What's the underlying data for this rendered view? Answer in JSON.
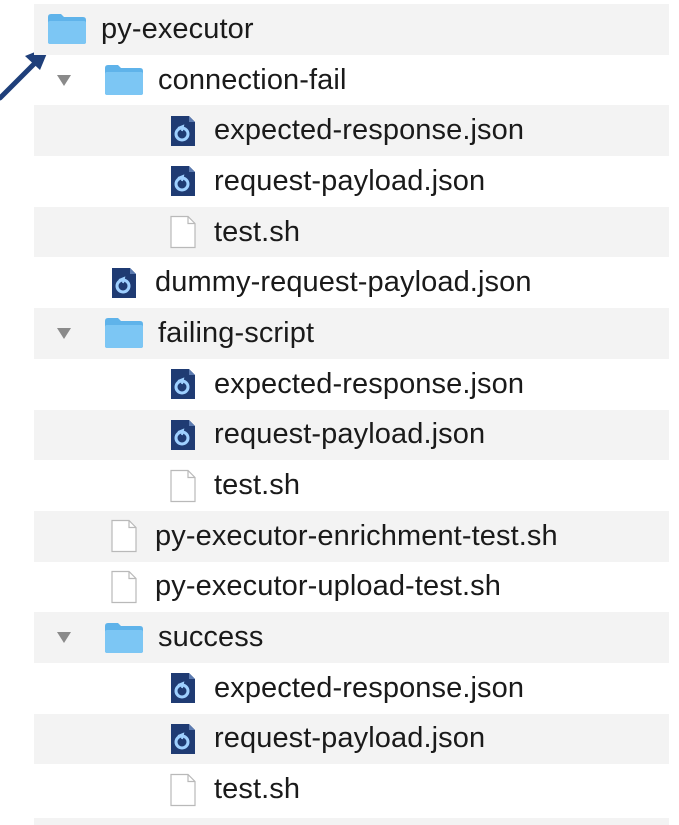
{
  "tree": {
    "root": "py-executor",
    "items": [
      {
        "label": "connection-fail",
        "kind": "folder",
        "depth": 1,
        "expanded": true
      },
      {
        "label": "expected-response.json",
        "kind": "json",
        "depth": 2
      },
      {
        "label": "request-payload.json",
        "kind": "json",
        "depth": 2
      },
      {
        "label": "test.sh",
        "kind": "file",
        "depth": 2
      },
      {
        "label": "dummy-request-payload.json",
        "kind": "json",
        "depth": 1
      },
      {
        "label": "failing-script",
        "kind": "folder",
        "depth": 1,
        "expanded": true
      },
      {
        "label": "expected-response.json",
        "kind": "json",
        "depth": 2
      },
      {
        "label": "request-payload.json",
        "kind": "json",
        "depth": 2
      },
      {
        "label": "test.sh",
        "kind": "file",
        "depth": 2
      },
      {
        "label": "py-executor-enrichment-test.sh",
        "kind": "file",
        "depth": 1
      },
      {
        "label": "py-executor-upload-test.sh",
        "kind": "file",
        "depth": 1
      },
      {
        "label": "success",
        "kind": "folder",
        "depth": 1,
        "expanded": true
      },
      {
        "label": "expected-response.json",
        "kind": "json",
        "depth": 2
      },
      {
        "label": "request-payload.json",
        "kind": "json",
        "depth": 2
      },
      {
        "label": "test.sh",
        "kind": "file",
        "depth": 2
      }
    ]
  },
  "icons": {
    "folder": "folder-icon",
    "json": "json-file-icon",
    "file": "generic-file-icon",
    "disclosure": "disclosure-triangle-icon",
    "pointer": "pointer-arrow-icon"
  },
  "colors": {
    "folder": "#7cc6f4",
    "folder_tab": "#5fb3ea",
    "json_icon": "#1f3b73",
    "arrow": "#1f3f7a",
    "stripe": "#f3f3f3"
  }
}
